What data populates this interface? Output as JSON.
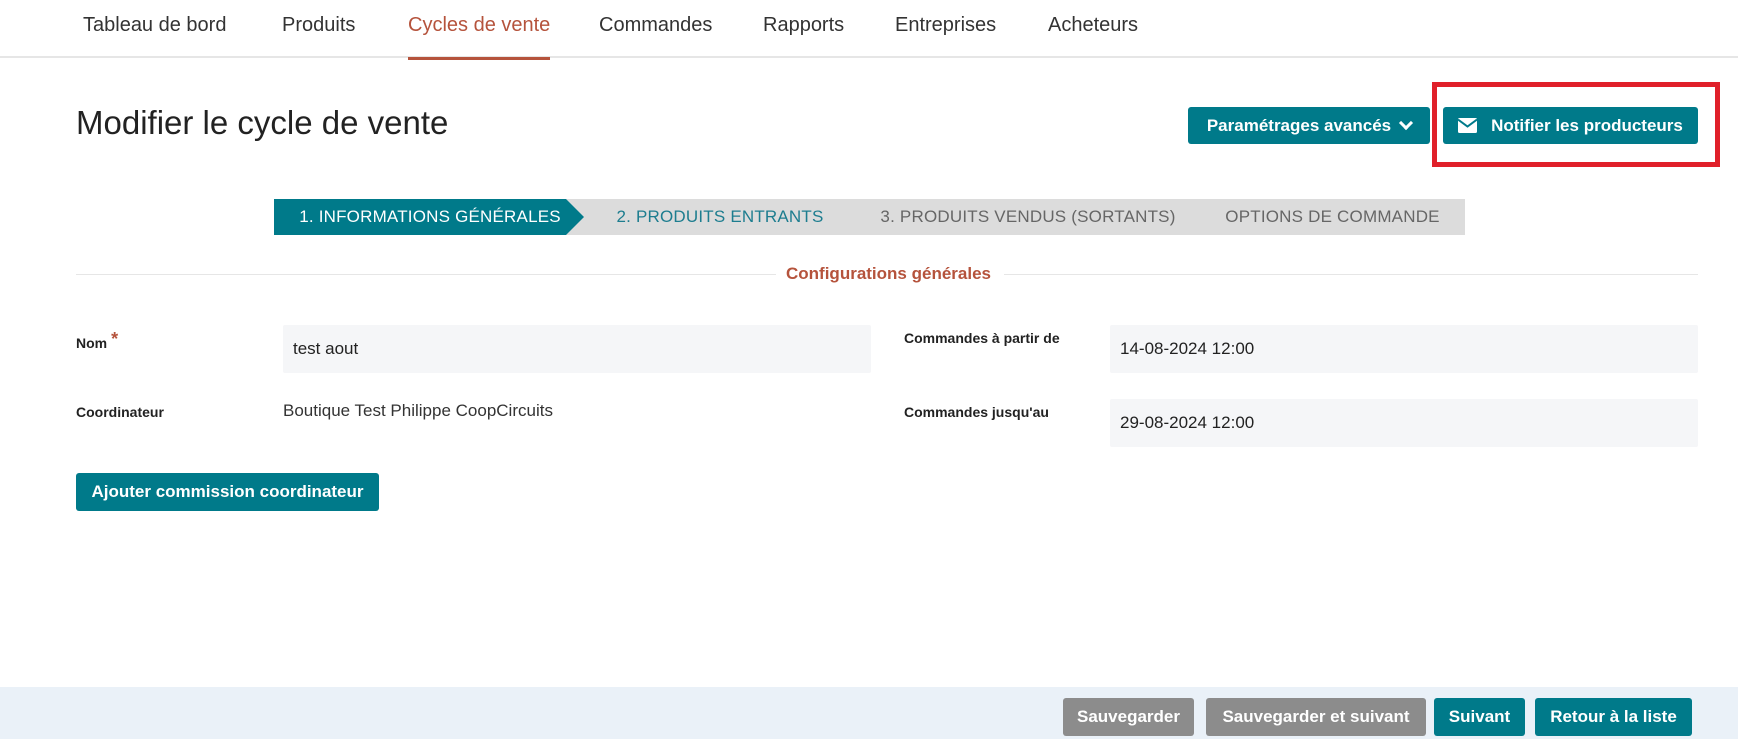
{
  "nav": {
    "items": [
      {
        "label": "Tableau de bord"
      },
      {
        "label": "Produits"
      },
      {
        "label": "Cycles de vente"
      },
      {
        "label": "Commandes"
      },
      {
        "label": "Rapports"
      },
      {
        "label": "Entreprises"
      },
      {
        "label": "Acheteurs"
      }
    ],
    "active": "Cycles de vente"
  },
  "header": {
    "title": "Modifier le cycle de vente",
    "advanced_label": "Paramétrages avancés",
    "notify_label": "Notifier les producteurs"
  },
  "stepper": {
    "steps": [
      {
        "label": "1. INFORMATIONS GÉNÉRALES",
        "state": "active"
      },
      {
        "label": "2. PRODUITS ENTRANTS",
        "state": "available"
      },
      {
        "label": "3. PRODUITS VENDUS (SORTANTS)",
        "state": "inactive"
      },
      {
        "label": "OPTIONS DE COMMANDE",
        "state": "inactive"
      }
    ]
  },
  "form": {
    "section_title": "Configurations générales",
    "name_label": "Nom",
    "required_mark": "*",
    "name_value": "test aout",
    "coordinator_label": "Coordinateur",
    "coordinator_value": "Boutique Test Philippe CoopCircuits",
    "orders_from_label": "Commandes à partir de",
    "orders_from_value": "14-08-2024 12:00",
    "orders_until_label": "Commandes jusqu'au",
    "orders_until_value": "29-08-2024 12:00",
    "add_commission_label": "Ajouter commission coordinateur"
  },
  "footer": {
    "save_label": "Sauvegarder",
    "save_next_label": "Sauvegarder et suivant",
    "next_label": "Suivant",
    "back_label": "Retour à la liste"
  },
  "colors": {
    "accent": "#b5533c",
    "primary": "#007a8a",
    "highlight": "#e0202a",
    "muted_button": "#8c8c8c",
    "footer_bg": "#eaf1f8"
  },
  "icons": {
    "advanced": "chevron-down-icon",
    "notify": "envelope-icon"
  }
}
